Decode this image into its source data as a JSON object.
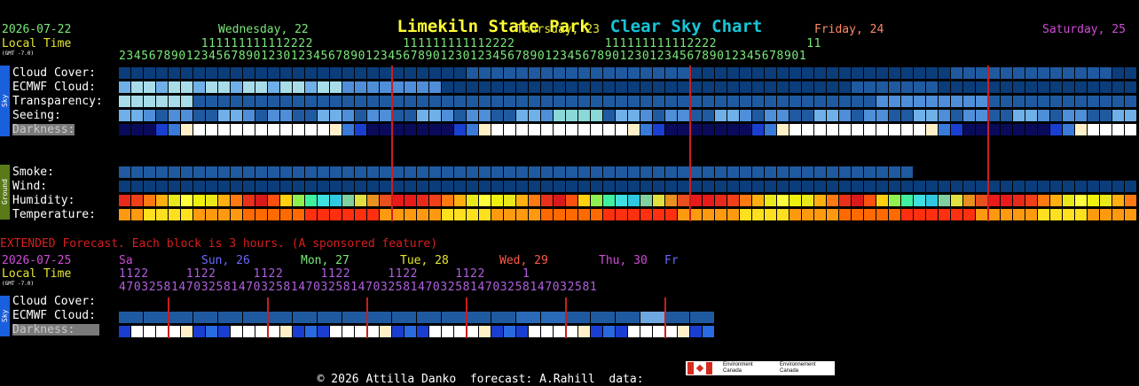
{
  "header": {
    "site_name": "Limekiln State Park",
    "chart_name": "Clear Sky Chart",
    "site_color": "#ffff33",
    "chart_color": "#17c6d8"
  },
  "main": {
    "date": "2026-07-22",
    "local_time_label": "Local Time",
    "gmt_offset": "(GMT -7.0)",
    "days": [
      {
        "label": "Wednesday, 22",
        "color": "#7ae97a"
      },
      {
        "label": "Thursday, 23",
        "color": "#e6e62e"
      },
      {
        "label": "Friday, 24",
        "color": "#ff8866"
      },
      {
        "label": "Saturday, 25",
        "color": "#d04dd8"
      }
    ],
    "hour_tens": "           111111111112222            111111111112222            111111111112222            11",
    "hour_ones": "23456789012345678901230123456789012345678901230123456789012345678901230123456789012345678901",
    "sky_tab": "Sky",
    "ground_tab": "Ground",
    "rows": [
      {
        "label": "Cloud Cover:"
      },
      {
        "label": "ECMWF Cloud:"
      },
      {
        "label": "Transparency:"
      },
      {
        "label": "Seeing:"
      },
      {
        "label": "Darkness:"
      },
      {
        "label": "Smoke:"
      },
      {
        "label": "Wind:"
      },
      {
        "label": "Humidity:"
      },
      {
        "label": "Temperature:"
      }
    ]
  },
  "extended": {
    "notice": "EXTENDED Forecast. Each block is 3 hours. (A sponsored feature)",
    "date": "2026-07-25",
    "local_time_label": "Local Time",
    "gmt_offset": "(GMT -7.0)",
    "days": [
      {
        "label": "Sa",
        "color": "#d04dd8"
      },
      {
        "label": "Sun, 26",
        "color": "#6a6aff"
      },
      {
        "label": "Mon, 27",
        "color": "#7ae97a"
      },
      {
        "label": "Tue, 28",
        "color": "#e6e62e"
      },
      {
        "label": "Wed, 29",
        "color": "#ff5a4a"
      },
      {
        "label": "Thu, 30",
        "color": "#d04dd8"
      },
      {
        "label": "Fr",
        "color": "#6a6aff"
      }
    ],
    "hour_tens": "1122     1122     1122     1122     1122     1122     1",
    "hour_ones": "4703258147032581470325814703258147032581470325814703258147032581",
    "sky_tab": "Sky",
    "rows": [
      {
        "label": "Cloud Cover:"
      },
      {
        "label": "ECMWF Cloud:"
      },
      {
        "label": "Darkness:"
      }
    ]
  },
  "footer": {
    "copyright": "© 2026 Attilla Danko",
    "forecast_credit": "forecast: A.Rahill",
    "data_label": "data:",
    "logo_text_en": "Environment Canada",
    "logo_text_fr": "Environnement Canada"
  },
  "colors": {
    "row_label": "#ffffff",
    "darkness_label_bg": "#7a7a7a",
    "day_line": "#cc1d1d",
    "sky_tab": "#1a5fdc",
    "ground_tab": "#5a7a1a",
    "extended_notice": "#d81e1e"
  }
}
